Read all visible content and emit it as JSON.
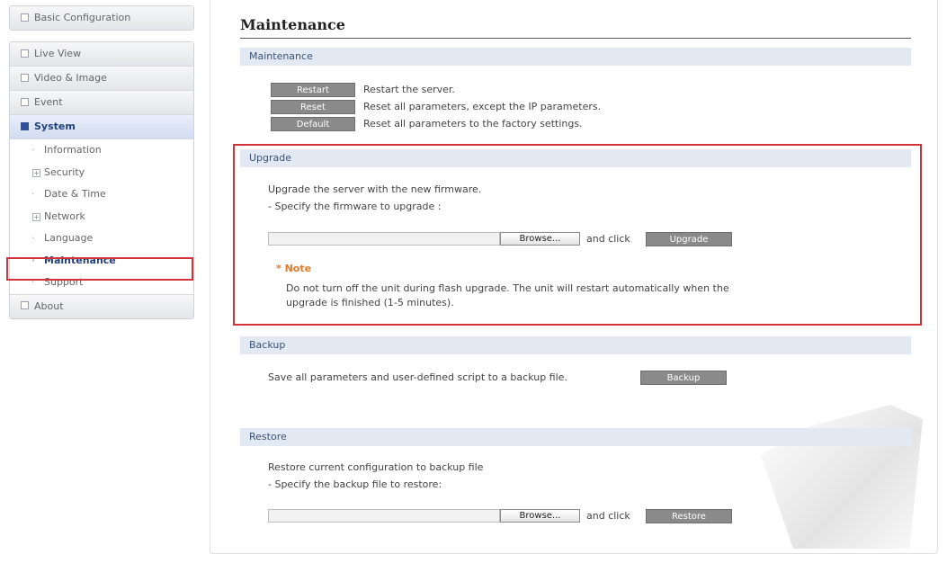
{
  "sidebar": {
    "basic_configuration": "Basic Configuration",
    "live_view": "Live View",
    "video_image": "Video & Image",
    "event": "Event",
    "system": "System",
    "system_items": [
      "Information",
      "Security",
      "Date & Time",
      "Network",
      "Language",
      "Maintenance",
      "Support"
    ],
    "about": "About"
  },
  "main": {
    "title": "Maintenance",
    "maintenance": {
      "header": "Maintenance",
      "restart_label": "Restart",
      "restart_desc": "Restart the server.",
      "reset_label": "Reset",
      "reset_desc": "Reset all parameters, except the IP parameters.",
      "default_label": "Default",
      "default_desc": "Reset all parameters to the factory settings."
    },
    "upgrade": {
      "header": "Upgrade",
      "line1": "Upgrade the server with the new firmware.",
      "line2": "- Specify the firmware to upgrade :",
      "browse_label": "Browse...",
      "and_click": "and click",
      "button_label": "Upgrade",
      "note_label": "* Note",
      "note_line1": "Do not turn off the unit during flash upgrade. The unit will restart automatically when the",
      "note_line2": "upgrade is finished (1-5 minutes)."
    },
    "backup": {
      "header": "Backup",
      "desc": "Save all parameters and user-defined script to a backup file.",
      "button_label": "Backup"
    },
    "restore": {
      "header": "Restore",
      "line1": "Restore current configuration to backup file",
      "line2": "- Specify the backup file to restore:",
      "browse_label": "Browse...",
      "and_click": "and click",
      "button_label": "Restore"
    }
  },
  "colors": {
    "highlight": "#d0343a",
    "section_bar": "#e3e9f3",
    "button_gray": "#8a8a8a",
    "active_menu": "#23407a",
    "note": "#e07a2a"
  }
}
